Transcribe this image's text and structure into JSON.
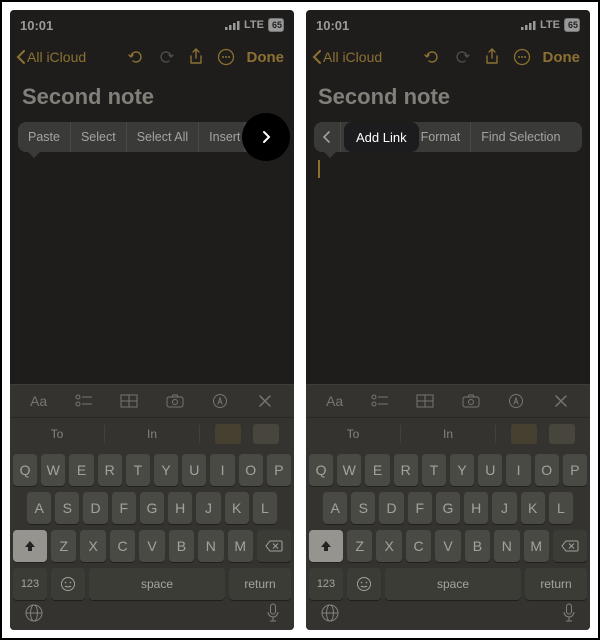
{
  "status": {
    "time": "10:01",
    "net": "LTE",
    "battery": "65"
  },
  "nav": {
    "back": "All iCloud",
    "done": "Done"
  },
  "note": {
    "title": "Second note"
  },
  "menu1": [
    "Paste",
    "Select",
    "Select All",
    "Insert"
  ],
  "menu2_left": "",
  "menu2_addlink": "Add Link",
  "menu2_rest": [
    "Format",
    "Find Selection"
  ],
  "predict": {
    "a": "To",
    "b": "In"
  },
  "rows": {
    "r1": [
      "Q",
      "W",
      "E",
      "R",
      "T",
      "Y",
      "U",
      "I",
      "O",
      "P"
    ],
    "r2": [
      "A",
      "S",
      "D",
      "F",
      "G",
      "H",
      "J",
      "K",
      "L"
    ],
    "r3": [
      "Z",
      "X",
      "C",
      "V",
      "B",
      "N",
      "M"
    ]
  },
  "fn": {
    "num": "123",
    "space": "space",
    "ret": "return"
  }
}
